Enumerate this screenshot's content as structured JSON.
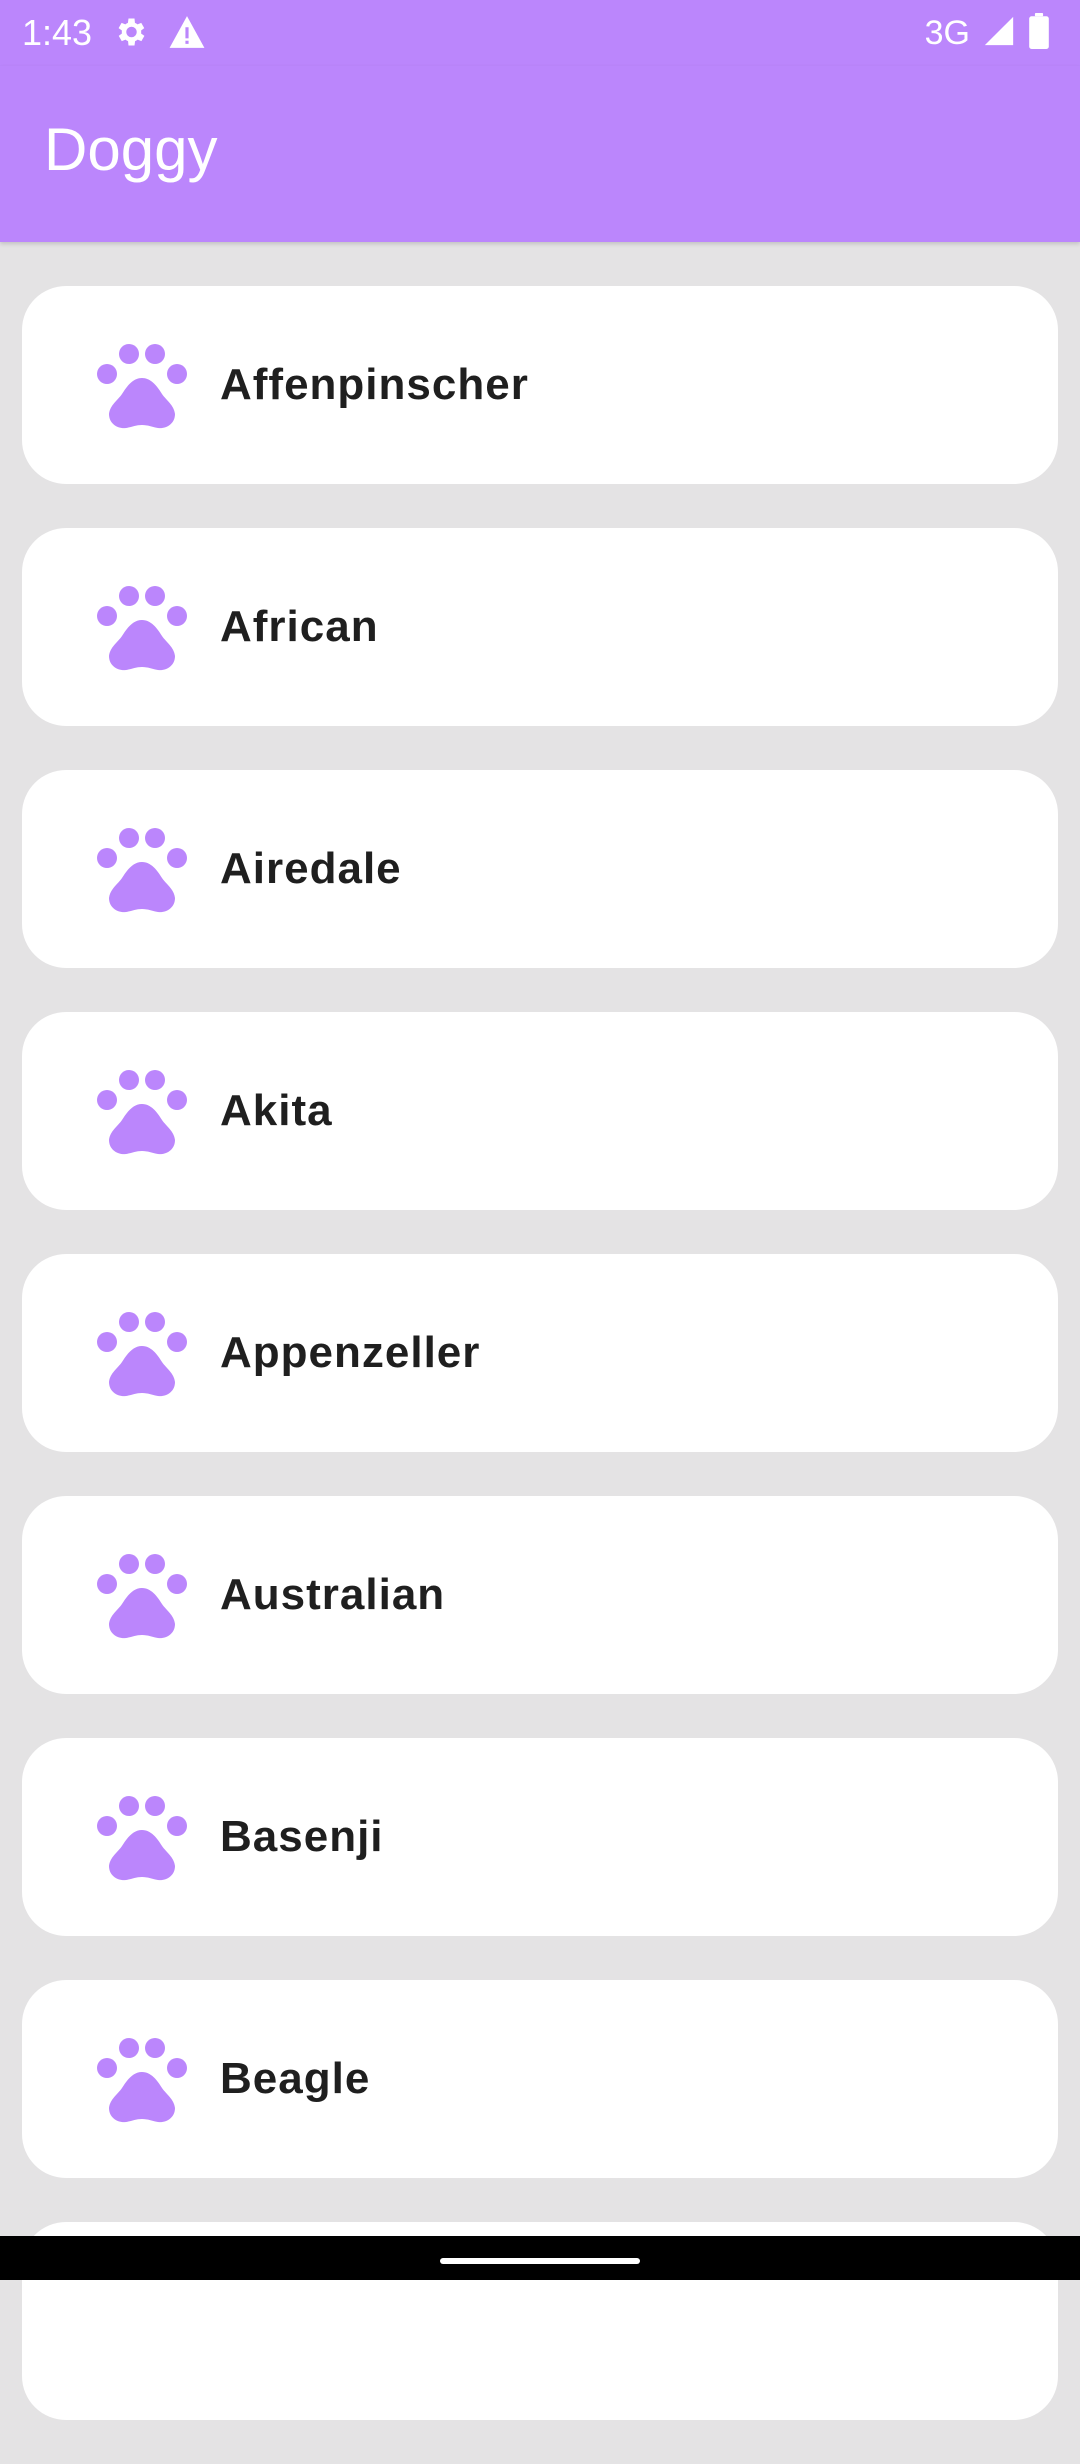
{
  "status_bar": {
    "time": "1:43",
    "network": "3G",
    "icons": [
      "gear-icon",
      "alert-triangle-icon",
      "signal-icon",
      "battery-icon"
    ]
  },
  "app_bar": {
    "title": "Doggy"
  },
  "breeds": [
    {
      "name": "Affenpinscher",
      "icon": "paw-icon"
    },
    {
      "name": "African",
      "icon": "paw-icon"
    },
    {
      "name": "Airedale",
      "icon": "paw-icon"
    },
    {
      "name": "Akita",
      "icon": "paw-icon"
    },
    {
      "name": "Appenzeller",
      "icon": "paw-icon"
    },
    {
      "name": "Australian",
      "icon": "paw-icon"
    },
    {
      "name": "Basenji",
      "icon": "paw-icon"
    },
    {
      "name": "Beagle",
      "icon": "paw-icon"
    }
  ],
  "colors": {
    "accent": "#bb86fc",
    "background": "#e4e3e4",
    "card": "#ffffff",
    "text": "#1f1f1f"
  }
}
